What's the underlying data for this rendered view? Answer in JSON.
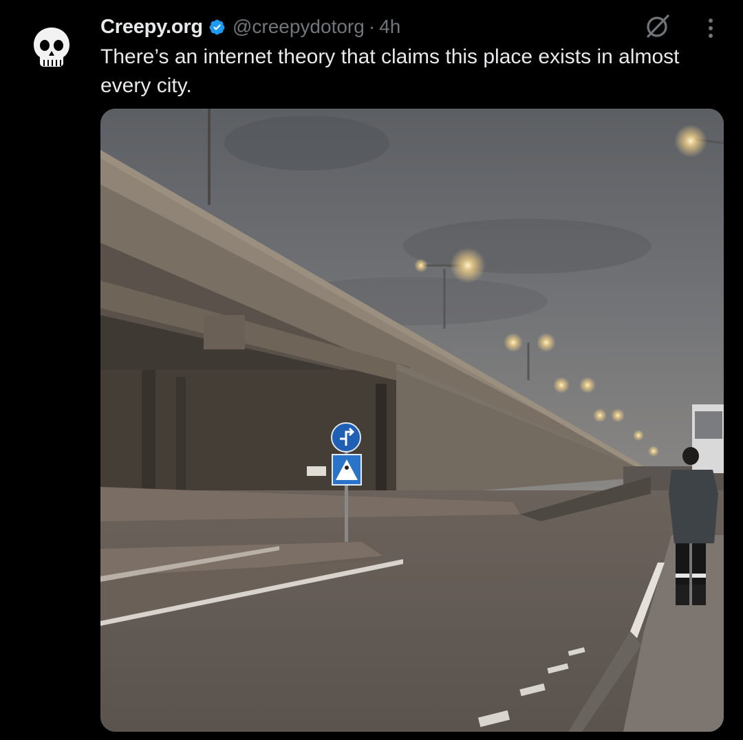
{
  "tweet": {
    "display_name": "Creepy.org",
    "handle": "@creepydotorg",
    "separator": "·",
    "time": "4h",
    "text": "There’s an internet theory that claims this place exists in almost every city.",
    "verified": true,
    "icons": {
      "avatar": "skull-avatar-icon",
      "verified": "verified-badge-icon",
      "grok": "grok-icon",
      "more": "more-vertical-icon"
    },
    "colors": {
      "background": "#000000",
      "text": "#e7e9ea",
      "secondary": "#71767b",
      "verified": "#1d9bf0"
    }
  }
}
